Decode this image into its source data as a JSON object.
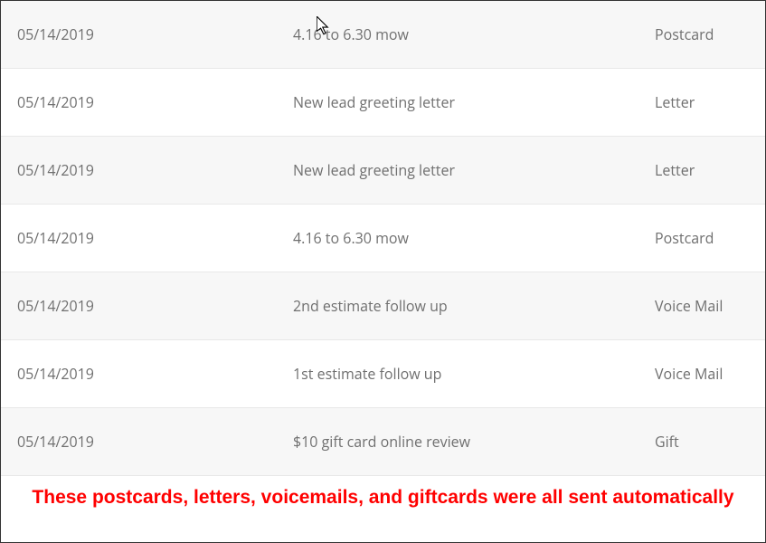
{
  "rows": [
    {
      "date": "05/14/2019",
      "description": "4.16 to 6.30 mow",
      "type": "Postcard"
    },
    {
      "date": "05/14/2019",
      "description": "New lead greeting letter",
      "type": "Letter"
    },
    {
      "date": "05/14/2019",
      "description": "New lead greeting letter",
      "type": "Letter"
    },
    {
      "date": "05/14/2019",
      "description": "4.16 to 6.30 mow",
      "type": "Postcard"
    },
    {
      "date": "05/14/2019",
      "description": "2nd estimate follow up",
      "type": "Voice Mail"
    },
    {
      "date": "05/14/2019",
      "description": "1st estimate follow up",
      "type": "Voice Mail"
    },
    {
      "date": "05/14/2019",
      "description": "$10 gift card online review",
      "type": "Gift"
    }
  ],
  "caption": "These postcards, letters, voicemails, and giftcards were all sent automatically"
}
